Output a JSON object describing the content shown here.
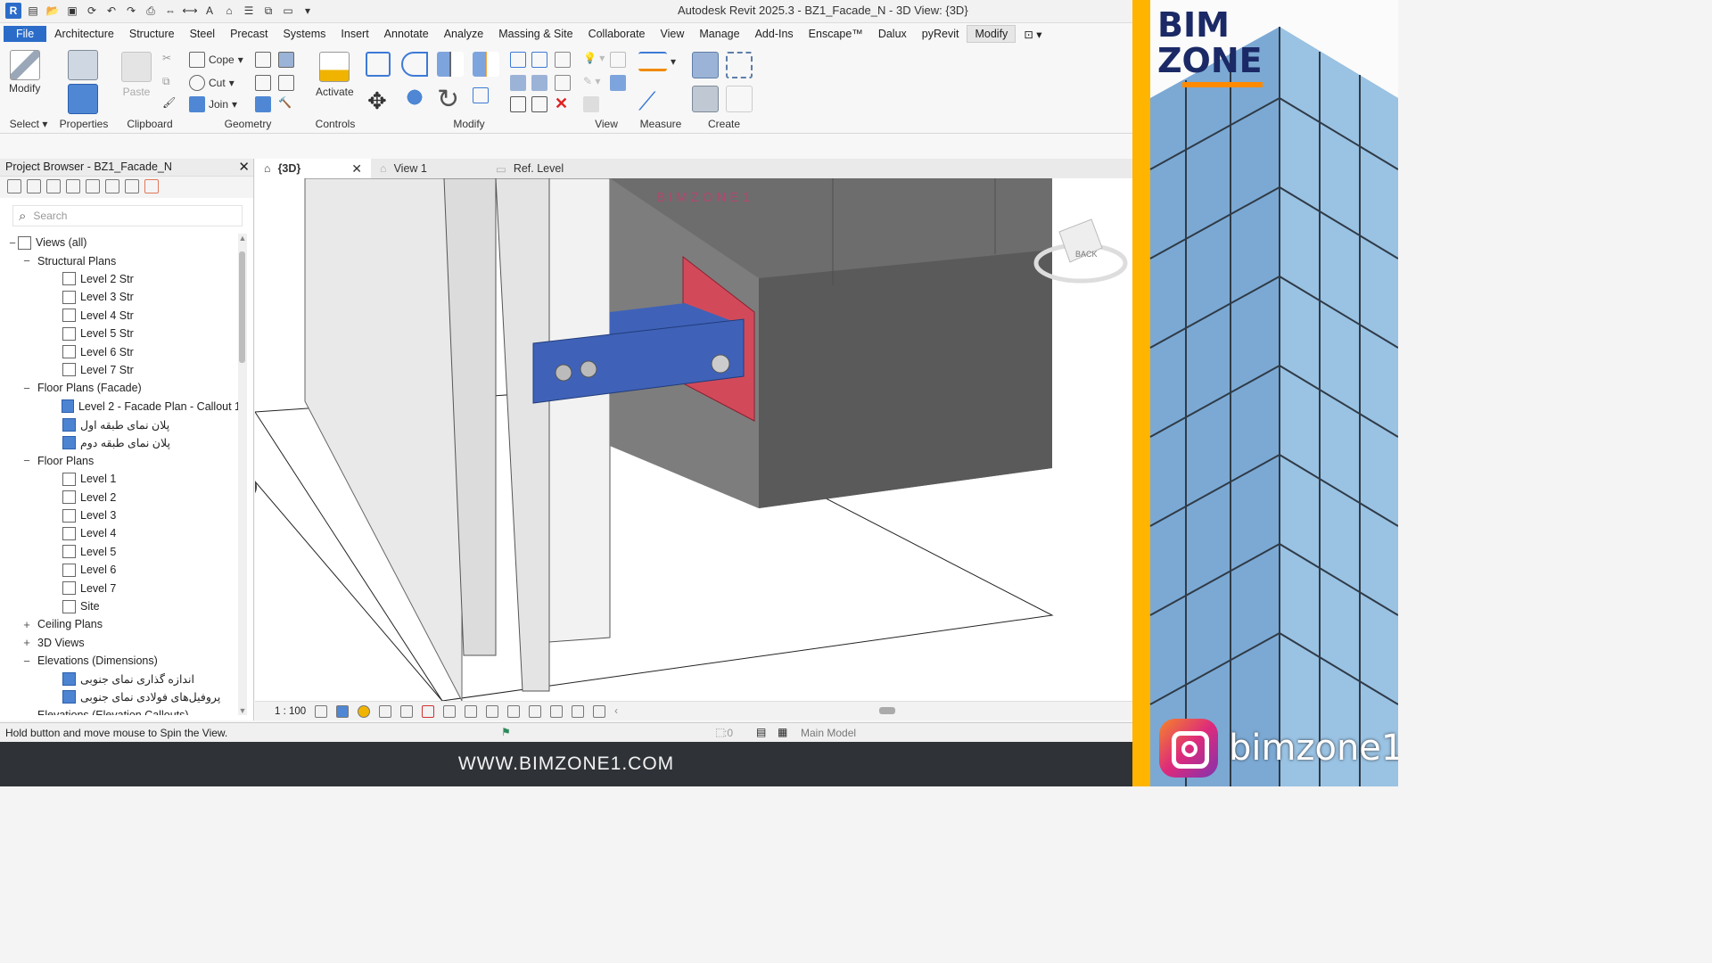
{
  "window": {
    "title": "Autodesk Revit 2025.3 - BZ1_Facade_N - 3D View: {3D}"
  },
  "menu": {
    "tabs": [
      "File",
      "Architecture",
      "Structure",
      "Steel",
      "Precast",
      "Systems",
      "Insert",
      "Annotate",
      "Analyze",
      "Massing & Site",
      "Collaborate",
      "View",
      "Manage",
      "Add-Ins",
      "Enscape™",
      "Dalux",
      "pyRevit",
      "Modify"
    ],
    "active": "Modify"
  },
  "ribbon": {
    "select": {
      "button": "Modify",
      "label": "Select"
    },
    "properties": {
      "label": "Properties"
    },
    "clipboard": {
      "paste": "Paste",
      "label": "Clipboard"
    },
    "geometry": {
      "cope": "Cope",
      "cut": "Cut",
      "join": "Join",
      "label": "Geometry"
    },
    "controls": {
      "activate": "Activate",
      "label": "Controls"
    },
    "modify": {
      "label": "Modify"
    },
    "view": {
      "label": "View"
    },
    "measure": {
      "label": "Measure"
    },
    "create": {
      "label": "Create"
    }
  },
  "browser": {
    "title": "Project Browser - BZ1_Facade_N",
    "search_placeholder": "Search",
    "items": [
      {
        "level": 0,
        "toggle": "−",
        "icon": "views",
        "label": "Views (all)"
      },
      {
        "level": 1,
        "toggle": "−",
        "label": "Structural Plans"
      },
      {
        "level": 2,
        "icon": "plan",
        "label": "Level 2 Str"
      },
      {
        "level": 2,
        "icon": "plan",
        "label": "Level 3 Str"
      },
      {
        "level": 2,
        "icon": "plan",
        "label": "Level 4 Str"
      },
      {
        "level": 2,
        "icon": "plan",
        "label": "Level 5 Str"
      },
      {
        "level": 2,
        "icon": "plan",
        "label": "Level 6 Str"
      },
      {
        "level": 2,
        "icon": "plan",
        "label": "Level 7 Str"
      },
      {
        "level": 1,
        "toggle": "−",
        "label": "Floor Plans (Facade)"
      },
      {
        "level": 2,
        "icon": "filled",
        "label": "Level 2 - Facade Plan - Callout 1"
      },
      {
        "level": 2,
        "icon": "filled",
        "label": "پلان نمای طبقه اول"
      },
      {
        "level": 2,
        "icon": "filled",
        "label": "پلان نمای طبقه دوم"
      },
      {
        "level": 1,
        "toggle": "−",
        "label": "Floor Plans"
      },
      {
        "level": 2,
        "icon": "plan",
        "label": "Level 1"
      },
      {
        "level": 2,
        "icon": "plan",
        "label": "Level 2"
      },
      {
        "level": 2,
        "icon": "plan",
        "label": "Level 3"
      },
      {
        "level": 2,
        "icon": "plan",
        "label": "Level 4"
      },
      {
        "level": 2,
        "icon": "plan",
        "label": "Level 5"
      },
      {
        "level": 2,
        "icon": "plan",
        "label": "Level 6"
      },
      {
        "level": 2,
        "icon": "plan",
        "label": "Level 7"
      },
      {
        "level": 2,
        "icon": "plan",
        "label": "Site"
      },
      {
        "level": 1,
        "toggle": "+",
        "label": "Ceiling Plans"
      },
      {
        "level": 1,
        "toggle": "+",
        "label": "3D Views"
      },
      {
        "level": 1,
        "toggle": "−",
        "label": "Elevations (Dimensions)"
      },
      {
        "level": 2,
        "icon": "filled",
        "label": "اندازه گذاری نمای جنوبی"
      },
      {
        "level": 2,
        "icon": "filled",
        "label": "پروفیل‌های فولادی نمای جنوبی"
      },
      {
        "level": 1,
        "toggle": "",
        "label": "Elevations (Elevation Callouts)"
      }
    ]
  },
  "view_tabs": [
    {
      "label": "{3D}",
      "active": true,
      "close": "✕"
    },
    {
      "label": "View 1",
      "active": false
    },
    {
      "label": "Ref. Level",
      "active": false
    }
  ],
  "canvas": {
    "watermark": "BIMZONE1",
    "viewcube_label": "BACK"
  },
  "view_bar": {
    "scale": "1 : 100"
  },
  "status": {
    "message": "Hold button and move mouse to Spin the View.",
    "selection_count": ":0",
    "model": "Main Model"
  },
  "footer": {
    "url": "WWW.BIMZONE1.COM"
  },
  "brand": {
    "logo_line1": "BIM",
    "logo_line2": "ZONE",
    "instagram": "bimzone1"
  },
  "colors": {
    "file_tab": "#2b6cc9",
    "steel_blue": "#3f62b8",
    "plate_red": "#d24a5a",
    "accent_yellow": "#ffb400"
  }
}
